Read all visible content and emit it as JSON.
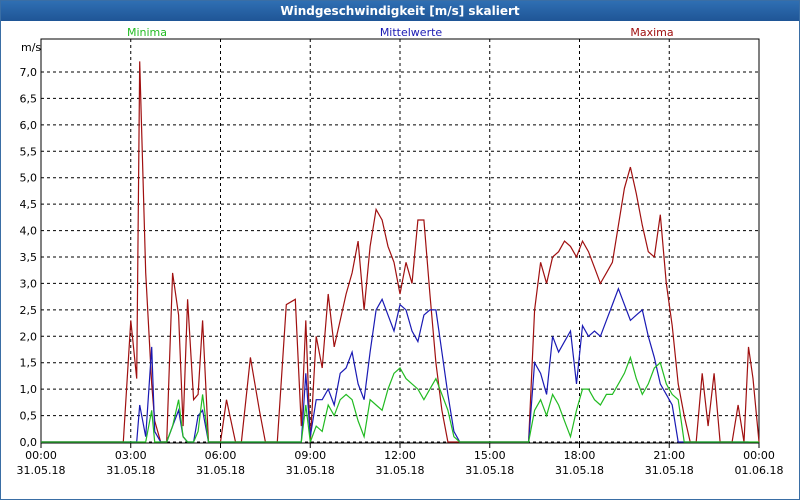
{
  "window": {
    "title": "Windgeschwindigkeit [m/s] skaliert"
  },
  "colors": {
    "min": "#22bb22",
    "mean": "#1a1ab4",
    "max": "#a01010",
    "grid": "#000000"
  },
  "chart_data": {
    "type": "line",
    "title": "Windgeschwindigkeit [m/s] skaliert",
    "ylabel": "m/s",
    "xlabel": "",
    "ylim": [
      0,
      7.5
    ],
    "xlim": [
      "31.05.18 00:00",
      "01.06.18 00:00"
    ],
    "y_ticks": [
      "0,0",
      "0,5",
      "1,0",
      "1,5",
      "2,0",
      "2,5",
      "3,0",
      "3,5",
      "4,0",
      "4,5",
      "5,0",
      "5,5",
      "6,0",
      "6,5",
      "7,0"
    ],
    "x_ticks": [
      {
        "time": "00:00",
        "date": "31.05.18"
      },
      {
        "time": "03:00",
        "date": "31.05.18"
      },
      {
        "time": "06:00",
        "date": "31.05.18"
      },
      {
        "time": "09:00",
        "date": "31.05.18"
      },
      {
        "time": "12:00",
        "date": "31.05.18"
      },
      {
        "time": "15:00",
        "date": "31.05.18"
      },
      {
        "time": "18:00",
        "date": "31.05.18"
      },
      {
        "time": "21:00",
        "date": "31.05.18"
      },
      {
        "time": "00:00",
        "date": "01.06.18"
      }
    ],
    "grid": true,
    "legend": "top",
    "x_hours": [
      0,
      2.75,
      3,
      3.2,
      3.3,
      3.5,
      3.7,
      3.8,
      4,
      4.2,
      4.4,
      4.6,
      4.75,
      4.9,
      5.1,
      5.25,
      5.4,
      5.6,
      5.8,
      6,
      6.2,
      6.5,
      6.7,
      7,
      7.3,
      7.5,
      7.7,
      7.9,
      8.2,
      8.5,
      8.7,
      8.85,
      9,
      9.2,
      9.4,
      9.6,
      9.8,
      10,
      10.2,
      10.4,
      10.6,
      10.8,
      11,
      11.2,
      11.4,
      11.6,
      11.8,
      12,
      12.2,
      12.4,
      12.6,
      12.8,
      13,
      13.2,
      13.4,
      13.6,
      13.8,
      14,
      14.2,
      14.5,
      14.8,
      15,
      15.3,
      15.6,
      15.9,
      16.1,
      16.3,
      16.5,
      16.7,
      16.9,
      17.1,
      17.3,
      17.5,
      17.7,
      17.9,
      18.1,
      18.3,
      18.5,
      18.7,
      18.9,
      19.1,
      19.3,
      19.5,
      19.7,
      19.9,
      20.1,
      20.3,
      20.5,
      20.7,
      20.9,
      21.1,
      21.3,
      21.5,
      21.7,
      21.9,
      22.1,
      22.3,
      22.5,
      22.7,
      22.9,
      23.1,
      23.3,
      23.5,
      23.65,
      23.8,
      24
    ],
    "series": [
      {
        "name": "Minima",
        "values": [
          0,
          0,
          0,
          0,
          0,
          0,
          0.6,
          0,
          0,
          0,
          0.3,
          0.8,
          0.1,
          0,
          0,
          0.2,
          0.9,
          0,
          0,
          0,
          0,
          0,
          0,
          0,
          0,
          0,
          0,
          0,
          0,
          0,
          0,
          0.7,
          0,
          0.3,
          0.2,
          0.7,
          0.5,
          0.8,
          0.9,
          0.8,
          0.4,
          0.1,
          0.8,
          0.7,
          0.6,
          1.0,
          1.3,
          1.4,
          1.2,
          1.1,
          1.0,
          0.8,
          1.0,
          1.2,
          0.9,
          0.6,
          0.1,
          0,
          0,
          0,
          0,
          0,
          0,
          0,
          0,
          0,
          0,
          0.6,
          0.8,
          0.5,
          0.9,
          0.7,
          0.4,
          0.1,
          0.6,
          1.0,
          1.0,
          0.8,
          0.7,
          0.9,
          0.9,
          1.1,
          1.3,
          1.6,
          1.2,
          0.9,
          1.1,
          1.4,
          1.5,
          1.1,
          0.9,
          0.8,
          0,
          0,
          0,
          0,
          0,
          0,
          0,
          0,
          0,
          0,
          0,
          0,
          0,
          0
        ]
      },
      {
        "name": "Mittelwerte",
        "values": [
          0,
          0,
          0,
          0,
          0.7,
          0.1,
          1.8,
          0.2,
          0,
          0,
          0.3,
          0.6,
          0.1,
          0,
          0,
          0.5,
          0.6,
          0,
          0,
          0,
          0,
          0,
          0,
          0,
          0,
          0,
          0,
          0,
          0,
          0,
          0,
          1.3,
          0.1,
          0.8,
          0.8,
          1.0,
          0.7,
          1.3,
          1.4,
          1.7,
          1.1,
          0.8,
          1.7,
          2.5,
          2.7,
          2.4,
          2.1,
          2.6,
          2.5,
          2.1,
          1.9,
          2.4,
          2.5,
          2.5,
          1.7,
          0.9,
          0.2,
          0,
          0,
          0,
          0,
          0,
          0,
          0,
          0,
          0,
          0,
          1.5,
          1.3,
          0.9,
          2.0,
          1.7,
          1.9,
          2.1,
          1.1,
          2.2,
          2.0,
          2.1,
          2.0,
          2.3,
          2.6,
          2.9,
          2.6,
          2.3,
          2.4,
          2.5,
          2.0,
          1.6,
          1.1,
          0.9,
          0.7,
          0,
          0,
          0,
          0,
          0,
          0,
          0,
          0,
          0,
          0,
          0,
          0,
          0
        ]
      },
      {
        "name": "Maxima",
        "values": [
          0,
          0,
          2.3,
          1.2,
          7.2,
          3.2,
          1.1,
          0.4,
          0,
          0,
          3.2,
          2.4,
          0.3,
          2.7,
          0.8,
          0.9,
          2.3,
          0,
          0,
          0,
          0.8,
          0,
          0,
          1.6,
          0.6,
          0,
          0,
          0,
          2.6,
          2.7,
          0.3,
          2.3,
          0,
          2.0,
          1.4,
          2.8,
          1.8,
          2.3,
          2.8,
          3.2,
          3.8,
          2.5,
          3.7,
          4.4,
          4.2,
          3.7,
          3.4,
          2.8,
          3.4,
          3.0,
          4.2,
          4.2,
          2.8,
          1.5,
          0.6,
          0,
          0,
          0,
          0,
          0,
          0,
          0,
          0,
          0,
          0,
          0,
          0,
          2.5,
          3.4,
          3.0,
          3.5,
          3.6,
          3.8,
          3.7,
          3.5,
          3.8,
          3.6,
          3.3,
          3.0,
          3.2,
          3.4,
          4.1,
          4.8,
          5.2,
          4.7,
          4.1,
          3.6,
          3.5,
          4.3,
          3.0,
          2.2,
          1.1,
          0.5,
          0,
          0,
          1.3,
          0.3,
          1.3,
          0,
          0,
          0,
          0.7,
          0,
          1.8,
          1.2,
          0
        ]
      }
    ]
  }
}
